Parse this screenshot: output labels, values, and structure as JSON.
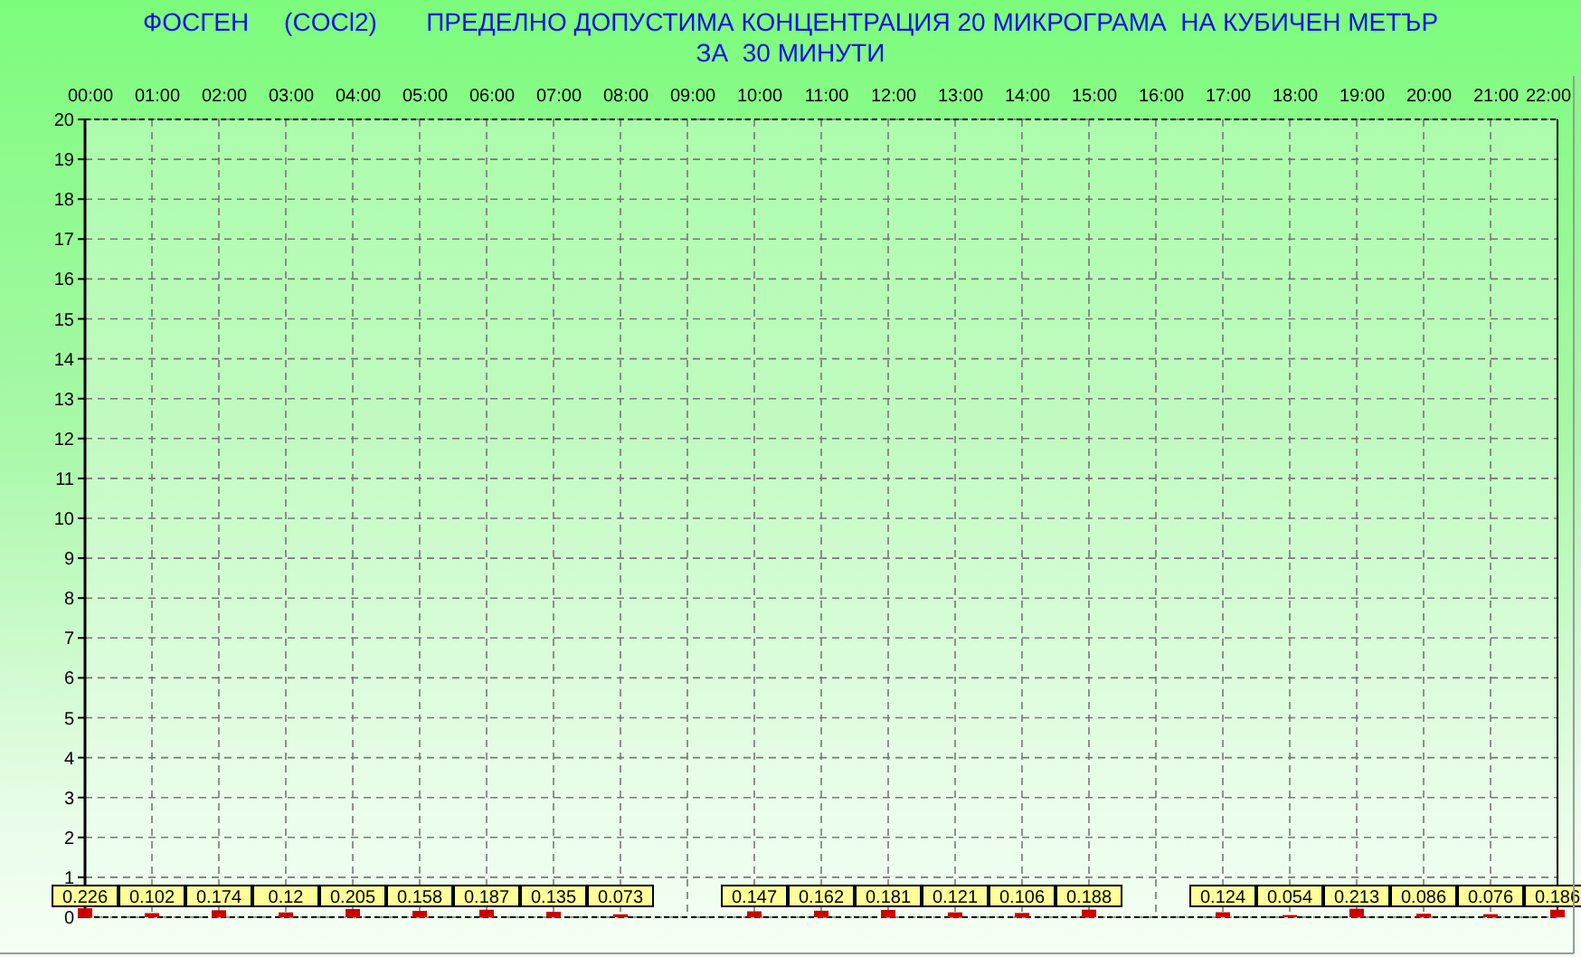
{
  "title": [
    "ФОСГЕН     (COCl2)       ПРЕДЕЛНО ДОПУСТИМА КОНЦЕНТРАЦИЯ 20 МИКРОГРАМА  НА КУБИЧЕН МЕТЪР",
    "ЗА  30 МИНУТИ"
  ],
  "chart_data": {
    "type": "bar",
    "categories": [
      "00:00",
      "01:00",
      "02:00",
      "03:00",
      "04:00",
      "05:00",
      "06:00",
      "07:00",
      "08:00",
      "09:00",
      "10:00",
      "11:00",
      "12:00",
      "13:00",
      "14:00",
      "15:00",
      "16:00",
      "17:00",
      "18:00",
      "19:00",
      "20:00",
      "21:00",
      "22:00"
    ],
    "series": [
      {
        "color": "#cc0000",
        "values": [
          0.226,
          0.102,
          0.174,
          0.12,
          0.205,
          0.158,
          0.187,
          0.135,
          0.073,
          null,
          0.147,
          0.162,
          0.181,
          0.121,
          0.106,
          0.188,
          null,
          0.124,
          0.054,
          0.213,
          0.086,
          0.076,
          0.186
        ]
      }
    ],
    "ylim": [
      0,
      20
    ],
    "yticks": [
      0,
      1,
      2,
      3,
      4,
      5,
      6,
      7,
      8,
      9,
      10,
      11,
      12,
      13,
      14,
      15,
      16,
      17,
      18,
      19,
      20
    ],
    "data_labels": true,
    "grid": true
  }
}
